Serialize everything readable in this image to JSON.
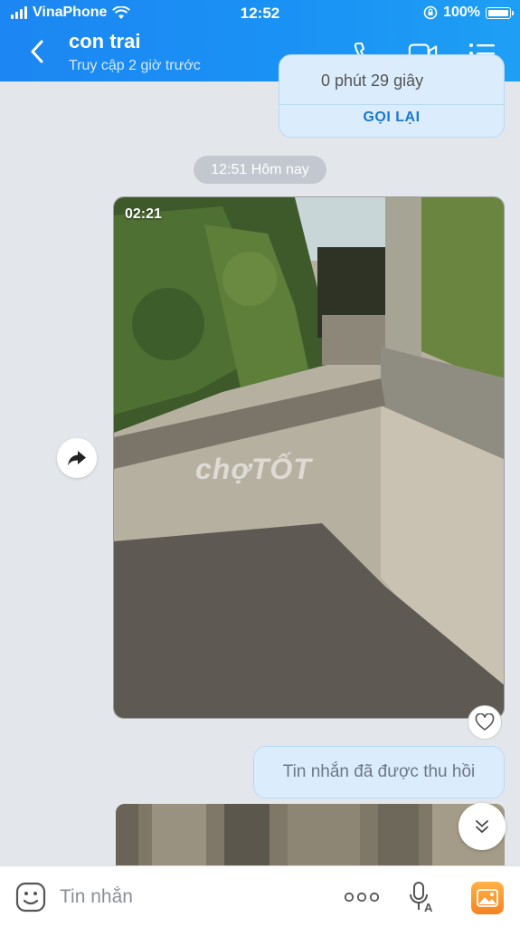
{
  "status_bar": {
    "carrier": "VinaPhone",
    "time": "12:52",
    "battery": "100%"
  },
  "header": {
    "title": "con trai",
    "subtitle": "Truy cập 2 giờ trước",
    "icons": [
      "back-icon",
      "phone-icon",
      "video-call-icon",
      "menu-icon"
    ]
  },
  "call_card": {
    "duration": "0 phút 29 giây",
    "action": "GỌI LẠI"
  },
  "time_chip": "12:51 Hôm nay",
  "video_message": {
    "duration": "02:21",
    "watermark": "chợTỐT"
  },
  "recalled_message": "Tin nhắn đã được thu hồi",
  "input_bar": {
    "placeholder": "Tin nhắn",
    "more_label": "ooo"
  },
  "colors": {
    "header": "#1a8ff4",
    "bubble": "#dbedfc",
    "accent": "#1977d2"
  }
}
